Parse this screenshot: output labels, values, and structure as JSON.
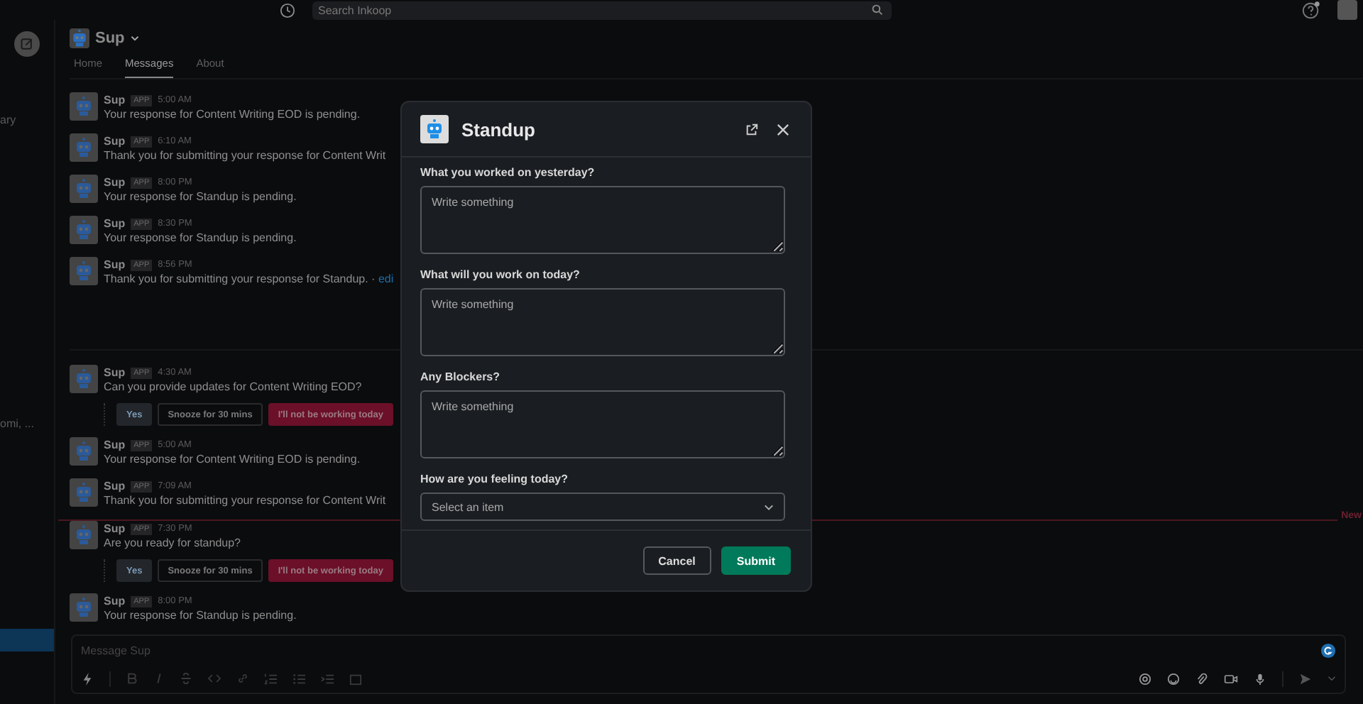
{
  "top_bar": {
    "search": {
      "placeholder": "Search Inkoop"
    }
  },
  "sidebar": {
    "items": [
      {
        "label": "ary"
      },
      {
        "label": "omi, ..."
      }
    ]
  },
  "channel": {
    "name": "Sup"
  },
  "tabs": [
    {
      "label": "Home",
      "selected": false
    },
    {
      "label": "Messages",
      "selected": true
    },
    {
      "label": "About",
      "selected": false
    }
  ],
  "timeline": [
    {
      "kind": "message",
      "sender": "Sup",
      "badge": "APP",
      "time": "5:00 AM",
      "text": "Your response for Content Writing EOD is pending."
    },
    {
      "kind": "message",
      "sender": "Sup",
      "badge": "APP",
      "time": "6:10 AM",
      "text": "Thank you for submitting your response for Content Writ"
    },
    {
      "kind": "message",
      "sender": "Sup",
      "badge": "APP",
      "time": "8:00 PM",
      "text": "Your response for Standup is pending."
    },
    {
      "kind": "message",
      "sender": "Sup",
      "badge": "APP",
      "time": "8:30 PM",
      "text": "Your response for Standup is pending."
    },
    {
      "kind": "message",
      "sender": "Sup",
      "badge": "APP",
      "time": "8:56 PM",
      "text": "Thank you for submitting your response for Standup. · ",
      "link": "edi"
    },
    {
      "kind": "divider"
    },
    {
      "kind": "message",
      "sender": "Sup",
      "badge": "APP",
      "time": "4:30 AM",
      "text": "Can you provide updates for Content Writing EOD?",
      "actions": [
        {
          "label": "Yes",
          "kind": "primary"
        },
        {
          "label": "Snooze for 30 mins",
          "kind": "default"
        },
        {
          "label": "I'll not be working today",
          "kind": "danger"
        }
      ]
    },
    {
      "kind": "message",
      "sender": "Sup",
      "badge": "APP",
      "time": "5:00 AM",
      "text": "Your response for Content Writing EOD is pending."
    },
    {
      "kind": "message",
      "sender": "Sup",
      "badge": "APP",
      "time": "7:09 AM",
      "text": "Thank you for submitting your response for Content Writ"
    },
    {
      "kind": "new_divider",
      "label": "New"
    },
    {
      "kind": "message",
      "sender": "Sup",
      "badge": "APP",
      "time": "7:30 PM",
      "text": "Are you ready for standup?",
      "actions": [
        {
          "label": "Yes",
          "kind": "primary"
        },
        {
          "label": "Snooze for 30 mins",
          "kind": "default"
        },
        {
          "label": "I'll not be working today",
          "kind": "danger"
        }
      ]
    },
    {
      "kind": "message",
      "sender": "Sup",
      "badge": "APP",
      "time": "8:00 PM",
      "text": "Your response for Standup is pending."
    }
  ],
  "composer": {
    "placeholder": "Message Sup"
  },
  "modal": {
    "title": "Standup",
    "fields": [
      {
        "kind": "textarea",
        "label": "What you worked on yesterday?",
        "placeholder": "Write something"
      },
      {
        "kind": "textarea",
        "label": "What will you work on today?",
        "placeholder": "Write something"
      },
      {
        "kind": "textarea",
        "label": "Any Blockers?",
        "placeholder": "Write something"
      },
      {
        "kind": "select",
        "label": "How are you feeling today?",
        "placeholder": "Select an item"
      }
    ],
    "buttons": [
      {
        "label": "Cancel",
        "kind": "secondary"
      },
      {
        "label": "Submit",
        "kind": "primary"
      }
    ]
  }
}
